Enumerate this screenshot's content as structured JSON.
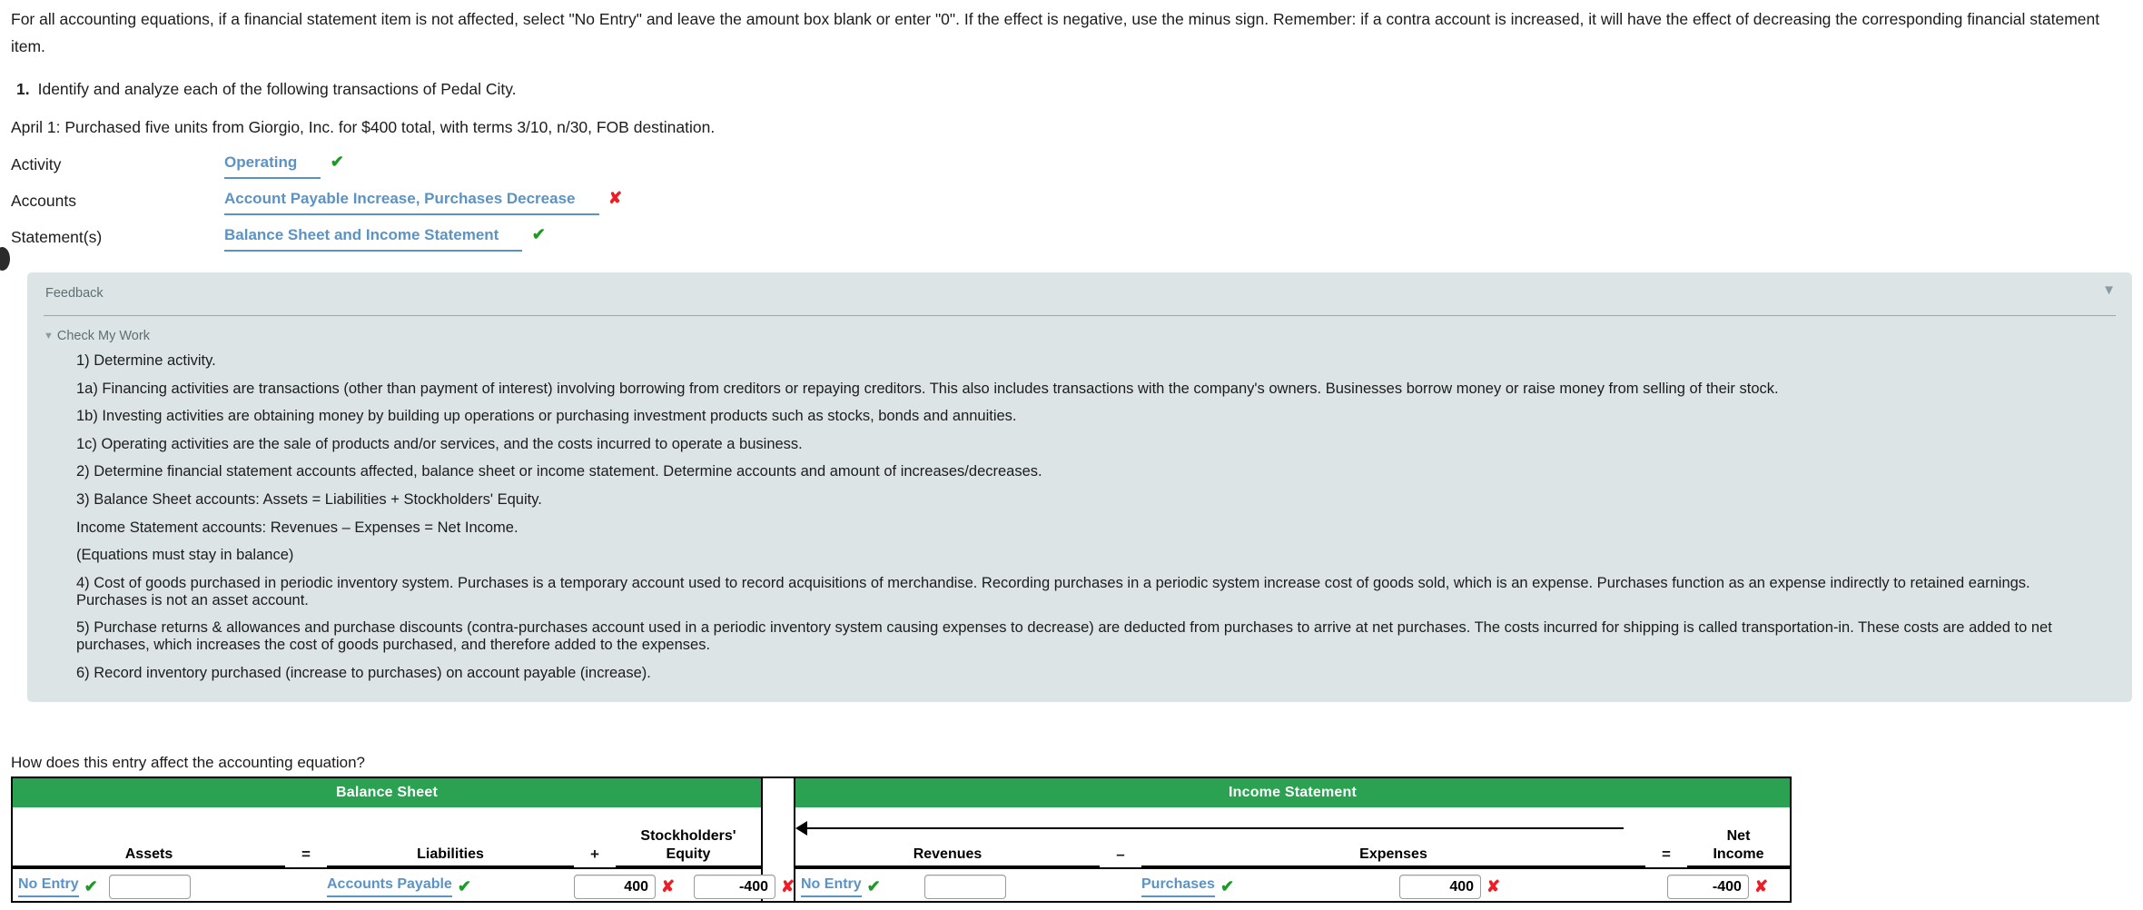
{
  "intro": {
    "text": "For all accounting equations, if a financial statement item is not affected, select \"No Entry\" and leave the amount box blank or enter \"0\". If the effect is negative, use the minus sign. Remember: if a contra account is increased, it will have the effect of decreasing the corresponding financial statement item."
  },
  "question": {
    "number": "1.",
    "text": "Identify and analyze each of the following transactions of Pedal City.",
    "transaction": "April 1: Purchased five units from Giorgio, Inc. for $400 total, with terms 3/10, n/30, FOB destination."
  },
  "answers": [
    {
      "label": "Activity",
      "value": "Operating",
      "mark": "check"
    },
    {
      "label": "Accounts",
      "value": "Account Payable Increase, Purchases Decrease",
      "mark": "cross"
    },
    {
      "label": "Statement(s)",
      "value": "Balance Sheet and Income Statement",
      "mark": "check"
    }
  ],
  "marks": {
    "check": "✔",
    "cross": "✘"
  },
  "feedback": {
    "title": "Feedback",
    "collapse_icon": "▼",
    "check_my_work_label": "Check My Work",
    "check_my_work_caret": "▼",
    "lines": [
      "1) Determine activity.",
      "1a) Financing activities are transactions (other than payment of interest) involving borrowing from creditors or repaying creditors. This also includes transactions with the company's owners. Businesses borrow money or raise money from selling of their stock.",
      "1b) Investing activities are obtaining money by building up operations or purchasing investment products such as stocks, bonds and annuities.",
      "1c) Operating activities are the sale of products and/or services, and the costs incurred to operate a business.",
      "2) Determine financial statement accounts affected, balance sheet or income statement. Determine accounts and amount of increases/decreases.",
      "3) Balance Sheet accounts: Assets = Liabilities + Stockholders' Equity.",
      "Income Statement accounts: Revenues – Expenses = Net Income.",
      "(Equations must stay in balance)",
      "4) Cost of goods purchased in periodic inventory system. Purchases is a temporary account used to record acquisitions of merchandise. Recording purchases in a periodic system increase cost of goods sold, which is an expense. Purchases function as an expense indirectly to retained earnings. Purchases is not an asset account.",
      "5) Purchase returns & allowances and purchase discounts (contra-purchases account used in a periodic inventory system causing expenses to decrease) are deducted from purchases to arrive at net purchases. The costs incurred for shipping is called transportation-in. These costs are added to net purchases, which increases the cost of goods purchased, and therefore added to the expenses.",
      "6) Record inventory purchased (increase to purchases) on account payable (increase)."
    ]
  },
  "equation": {
    "prompt": "How does this entry affect the accounting equation?",
    "balance_sheet_header": "Balance Sheet",
    "income_statement_header": "Income Statement",
    "columns": {
      "assets": "Assets",
      "eq1": "=",
      "liabilities": "Liabilities",
      "plus": "+",
      "stockholders": "Stockholders'",
      "equity": "Equity",
      "revenues": "Revenues",
      "minus": "–",
      "expenses": "Expenses",
      "eq2": "=",
      "net": "Net",
      "income": "Income"
    },
    "cells": {
      "assets_account": "No Entry",
      "assets_account_mark": "check",
      "assets_amount": "",
      "assets_amount_mark": "",
      "liabilities_account": "Accounts Payable",
      "liabilities_account_mark": "check",
      "liabilities_amount": "400",
      "liabilities_amount_mark": "cross",
      "equity_amount": "-400",
      "equity_amount_mark": "cross",
      "revenues_account": "No Entry",
      "revenues_account_mark": "check",
      "revenues_amount": "",
      "revenues_amount_mark": "",
      "expenses_account": "Purchases",
      "expenses_account_mark": "check",
      "expenses_amount": "400",
      "expenses_amount_mark": "cross",
      "net_income_amount": "-400",
      "net_income_amount_mark": "cross"
    }
  },
  "colors": {
    "green_header": "#2aa251",
    "link_blue": "#5b93c4",
    "check_green": "#1d9a28",
    "cross_red": "#ee1c25",
    "feedback_bg": "#dde4e6"
  }
}
